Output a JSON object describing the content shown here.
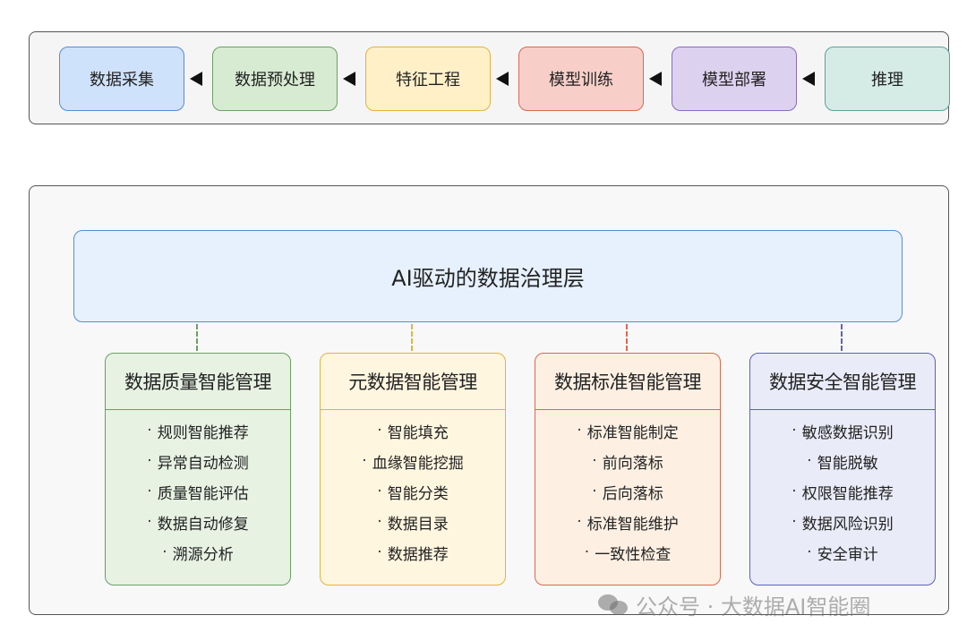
{
  "pipeline": {
    "stages": [
      {
        "label": "数据采集",
        "fill": "#cfe2fb",
        "stroke": "#5b8bd6"
      },
      {
        "label": "数据预处理",
        "fill": "#d7ebd3",
        "stroke": "#6aa063"
      },
      {
        "label": "特征工程",
        "fill": "#fff0c8",
        "stroke": "#e2b33e"
      },
      {
        "label": "模型训练",
        "fill": "#f8cfc8",
        "stroke": "#d9694f"
      },
      {
        "label": "模型部署",
        "fill": "#dcd1ee",
        "stroke": "#8a6bc2"
      },
      {
        "label": "推理",
        "fill": "#d5ebe6",
        "stroke": "#5ea295"
      }
    ]
  },
  "governance": {
    "header": {
      "title": "AI驱动的数据治理层"
    },
    "modules": [
      {
        "title": "数据质量智能管理",
        "fill": "#e7f2e3",
        "stroke": "#6aa063",
        "items": [
          "规则智能推荐",
          "异常自动检测",
          "质量智能评估",
          "数据自动修复",
          "溯源分析"
        ]
      },
      {
        "title": "元数据智能管理",
        "fill": "#fff6df",
        "stroke": "#e2b33e",
        "items": [
          "智能填充",
          "血缘智能挖掘",
          "智能分类",
          "数据目录",
          "数据推荐"
        ]
      },
      {
        "title": "数据标准智能管理",
        "fill": "#fdf0e3",
        "stroke": "#d9694f",
        "items": [
          "标准智能制定",
          "前向落标",
          "后向落标",
          "标准智能维护",
          "一致性检查"
        ]
      },
      {
        "title": "数据安全智能管理",
        "fill": "#e9ebf8",
        "stroke": "#5b62c4",
        "items": [
          "敏感数据识别",
          "智能脱敏",
          "权限智能推荐",
          "数据风险识别",
          "安全审计"
        ]
      }
    ]
  },
  "bullet": "·",
  "watermark": {
    "text": "公众号 · 大数据AI智能圈",
    "icon": "wechat-icon"
  }
}
